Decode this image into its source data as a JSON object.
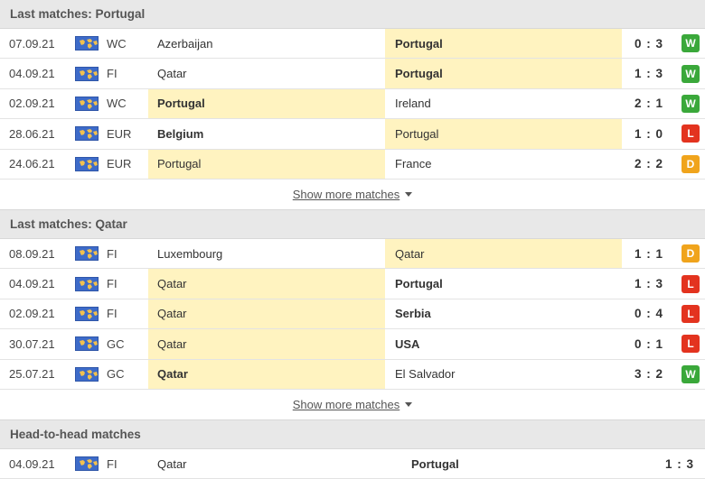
{
  "sections": [
    {
      "title": "Last matches: Portugal",
      "matches": [
        {
          "date": "07.09.21",
          "comp": "WC",
          "home": "Azerbaijan",
          "away": "Portugal",
          "score": "0 : 3",
          "result": "W",
          "winner": "away",
          "bold": "away"
        },
        {
          "date": "04.09.21",
          "comp": "FI",
          "home": "Qatar",
          "away": "Portugal",
          "score": "1 : 3",
          "result": "W",
          "winner": "away",
          "bold": "away"
        },
        {
          "date": "02.09.21",
          "comp": "WC",
          "home": "Portugal",
          "away": "Ireland",
          "score": "2 : 1",
          "result": "W",
          "winner": "home",
          "bold": "home"
        },
        {
          "date": "28.06.21",
          "comp": "EUR",
          "home": "Belgium",
          "away": "Portugal",
          "score": "1 : 0",
          "result": "L",
          "winner": "away",
          "bold": "home"
        },
        {
          "date": "24.06.21",
          "comp": "EUR",
          "home": "Portugal",
          "away": "France",
          "score": "2 : 2",
          "result": "D",
          "winner": "home",
          "bold": "none"
        }
      ],
      "show_more": "Show more matches"
    },
    {
      "title": "Last matches: Qatar",
      "matches": [
        {
          "date": "08.09.21",
          "comp": "FI",
          "home": "Luxembourg",
          "away": "Qatar",
          "score": "1 : 1",
          "result": "D",
          "winner": "away",
          "bold": "none"
        },
        {
          "date": "04.09.21",
          "comp": "FI",
          "home": "Qatar",
          "away": "Portugal",
          "score": "1 : 3",
          "result": "L",
          "winner": "home",
          "bold": "away"
        },
        {
          "date": "02.09.21",
          "comp": "FI",
          "home": "Qatar",
          "away": "Serbia",
          "score": "0 : 4",
          "result": "L",
          "winner": "home",
          "bold": "away"
        },
        {
          "date": "30.07.21",
          "comp": "GC",
          "home": "Qatar",
          "away": "USA",
          "score": "0 : 1",
          "result": "L",
          "winner": "home",
          "bold": "away"
        },
        {
          "date": "25.07.21",
          "comp": "GC",
          "home": "Qatar",
          "away": "El Salvador",
          "score": "3 : 2",
          "result": "W",
          "winner": "home",
          "bold": "home"
        }
      ],
      "show_more": "Show more matches"
    }
  ],
  "h2h": {
    "title": "Head-to-head matches",
    "matches": [
      {
        "date": "04.09.21",
        "comp": "FI",
        "home": "Qatar",
        "away": "Portugal",
        "score": "1 : 3",
        "bold": "away"
      }
    ]
  },
  "colors": {
    "win": "#3aa83a",
    "loss": "#e3331f",
    "draw": "#f0a41c",
    "highlight": "#fff3c0",
    "header_bg": "#e8e8e8"
  },
  "icons": {
    "flag": "world-flag-icon",
    "caret": "caret-down-icon"
  }
}
